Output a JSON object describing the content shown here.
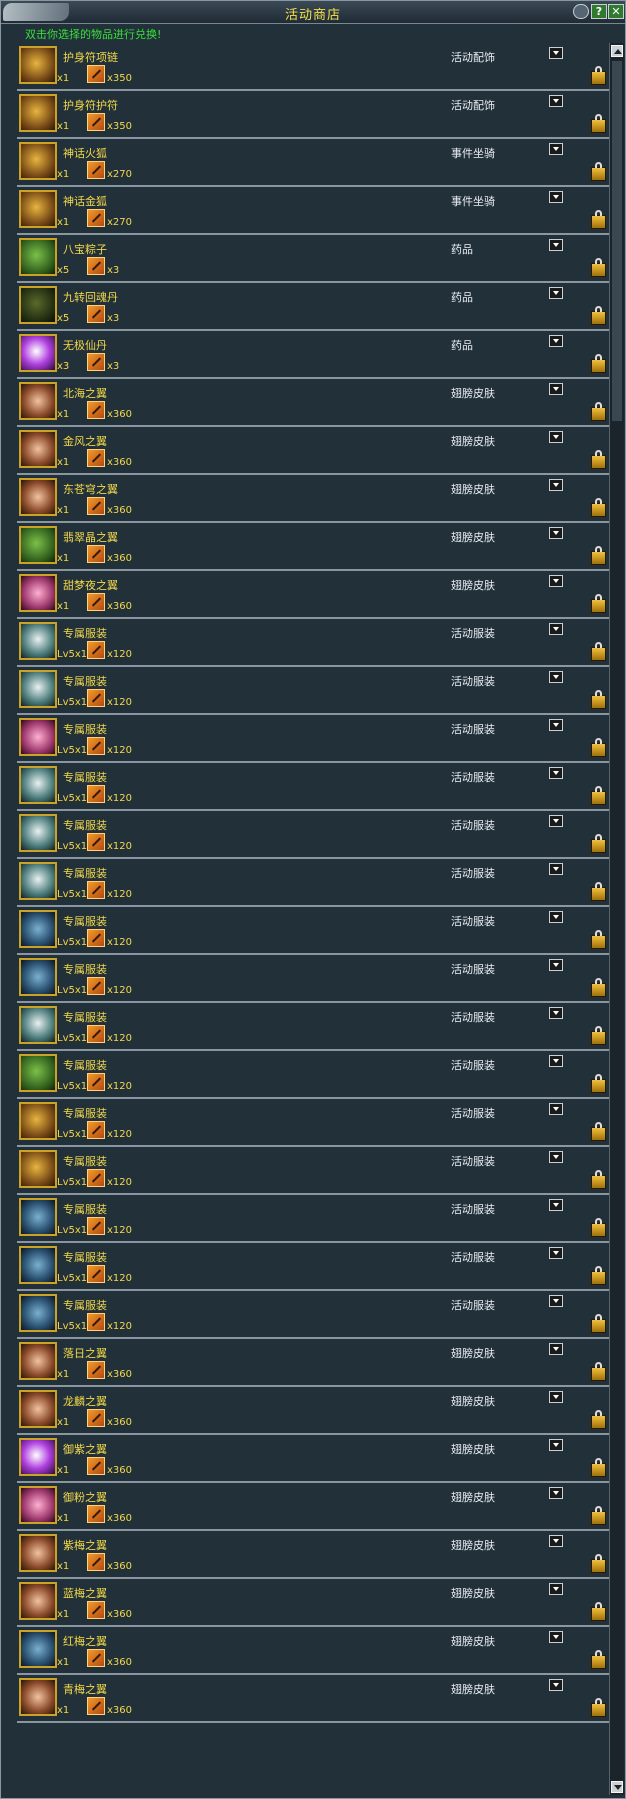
{
  "window": {
    "title": "活动商店",
    "instruction": "双击你选择的物品进行兑换!",
    "help_label": "?",
    "close_label": "✕"
  },
  "items": [
    {
      "name": "护身符项链",
      "qty": "x1",
      "cost": "x350",
      "category": "活动配饰",
      "icon": "gold"
    },
    {
      "name": "护身符护符",
      "qty": "x1",
      "cost": "x350",
      "category": "活动配饰",
      "icon": "gold"
    },
    {
      "name": "神话火狐",
      "qty": "x1",
      "cost": "x270",
      "category": "事件坐骑",
      "icon": "gold"
    },
    {
      "name": "神话金狐",
      "qty": "x1",
      "cost": "x270",
      "category": "事件坐骑",
      "icon": "gold"
    },
    {
      "name": "八宝粽子",
      "qty": "x5",
      "cost": "x3",
      "category": "药品",
      "icon": "green"
    },
    {
      "name": "九转回魂丹",
      "qty": "x5",
      "cost": "x3",
      "category": "药品",
      "icon": "dark"
    },
    {
      "name": "无极仙丹",
      "qty": "x3",
      "cost": "x3",
      "category": "药品",
      "icon": "violet"
    },
    {
      "name": "北海之翼",
      "qty": "x1",
      "cost": "x360",
      "category": "翅膀皮肤",
      "icon": "wing"
    },
    {
      "name": "金风之翼",
      "qty": "x1",
      "cost": "x360",
      "category": "翅膀皮肤",
      "icon": "wing"
    },
    {
      "name": "东苍穹之翼",
      "qty": "x1",
      "cost": "x360",
      "category": "翅膀皮肤",
      "icon": "wing"
    },
    {
      "name": "翡翠晶之翼",
      "qty": "x1",
      "cost": "x360",
      "category": "翅膀皮肤",
      "icon": "green"
    },
    {
      "name": "甜梦夜之翼",
      "qty": "x1",
      "cost": "x360",
      "category": "翅膀皮肤",
      "icon": "pink"
    },
    {
      "name": "专属服装",
      "qty": "Lv5x1",
      "cost": "x120",
      "category": "活动服装",
      "icon": "cloth"
    },
    {
      "name": "专属服装",
      "qty": "Lv5x1",
      "cost": "x120",
      "category": "活动服装",
      "icon": "cloth"
    },
    {
      "name": "专属服装",
      "qty": "Lv5x1",
      "cost": "x120",
      "category": "活动服装",
      "icon": "pink"
    },
    {
      "name": "专属服装",
      "qty": "Lv5x1",
      "cost": "x120",
      "category": "活动服装",
      "icon": "cloth"
    },
    {
      "name": "专属服装",
      "qty": "Lv5x1",
      "cost": "x120",
      "category": "活动服装",
      "icon": "cloth"
    },
    {
      "name": "专属服装",
      "qty": "Lv5x1",
      "cost": "x120",
      "category": "活动服装",
      "icon": "cloth"
    },
    {
      "name": "专属服装",
      "qty": "Lv5x1",
      "cost": "x120",
      "category": "活动服装",
      "icon": "book"
    },
    {
      "name": "专属服装",
      "qty": "Lv5x1",
      "cost": "x120",
      "category": "活动服装",
      "icon": "book"
    },
    {
      "name": "专属服装",
      "qty": "Lv5x1",
      "cost": "x120",
      "category": "活动服装",
      "icon": "cloth"
    },
    {
      "name": "专属服装",
      "qty": "Lv5x1",
      "cost": "x120",
      "category": "活动服装",
      "icon": "green"
    },
    {
      "name": "专属服装",
      "qty": "Lv5x1",
      "cost": "x120",
      "category": "活动服装",
      "icon": "gold"
    },
    {
      "name": "专属服装",
      "qty": "Lv5x1",
      "cost": "x120",
      "category": "活动服装",
      "icon": "gold"
    },
    {
      "name": "专属服装",
      "qty": "Lv5x1",
      "cost": "x120",
      "category": "活动服装",
      "icon": "book"
    },
    {
      "name": "专属服装",
      "qty": "Lv5x1",
      "cost": "x120",
      "category": "活动服装",
      "icon": "book"
    },
    {
      "name": "专属服装",
      "qty": "Lv5x1",
      "cost": "x120",
      "category": "活动服装",
      "icon": "book"
    },
    {
      "name": "落日之翼",
      "qty": "x1",
      "cost": "x360",
      "category": "翅膀皮肤",
      "icon": "wing"
    },
    {
      "name": "龙麟之翼",
      "qty": "x1",
      "cost": "x360",
      "category": "翅膀皮肤",
      "icon": "wing"
    },
    {
      "name": "御紫之翼",
      "qty": "x1",
      "cost": "x360",
      "category": "翅膀皮肤",
      "icon": "violet"
    },
    {
      "name": "御粉之翼",
      "qty": "x1",
      "cost": "x360",
      "category": "翅膀皮肤",
      "icon": "pink"
    },
    {
      "name": "紫梅之翼",
      "qty": "x1",
      "cost": "x360",
      "category": "翅膀皮肤",
      "icon": "wing"
    },
    {
      "name": "蓝梅之翼",
      "qty": "x1",
      "cost": "x360",
      "category": "翅膀皮肤",
      "icon": "wing"
    },
    {
      "name": "红梅之翼",
      "qty": "x1",
      "cost": "x360",
      "category": "翅膀皮肤",
      "icon": "book"
    },
    {
      "name": "青梅之翼",
      "qty": "x1",
      "cost": "x360",
      "category": "翅膀皮肤",
      "icon": "wing"
    }
  ],
  "colors": {
    "panel": "#22303a",
    "name": "#f2d94a",
    "instruction": "#38e038",
    "category": "#e8eef2"
  }
}
